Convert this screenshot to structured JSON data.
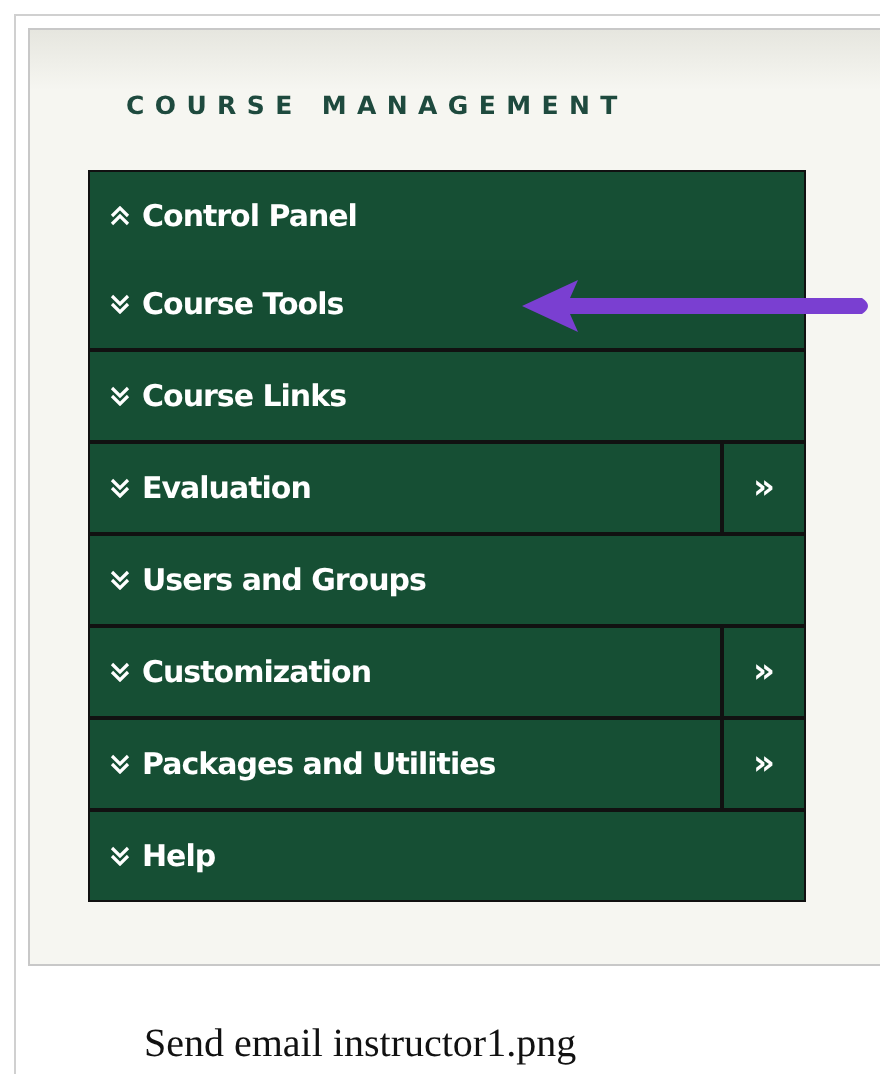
{
  "header": "COURSE MANAGEMENT",
  "menu": [
    {
      "label": "Control Panel",
      "expanded": true,
      "children": [
        {
          "label": "Course Tools",
          "expanded": false,
          "pointed": true
        }
      ]
    },
    {
      "label": "Course Links",
      "expanded": false
    },
    {
      "label": "Evaluation",
      "expanded": false,
      "side": "»"
    },
    {
      "label": "Users and Groups",
      "expanded": false
    },
    {
      "label": "Customization",
      "expanded": false,
      "side": "»"
    },
    {
      "label": "Packages and Utilities",
      "expanded": false,
      "side": "»"
    },
    {
      "label": "Help",
      "expanded": false
    }
  ],
  "caption": "Send email instructor1.png"
}
